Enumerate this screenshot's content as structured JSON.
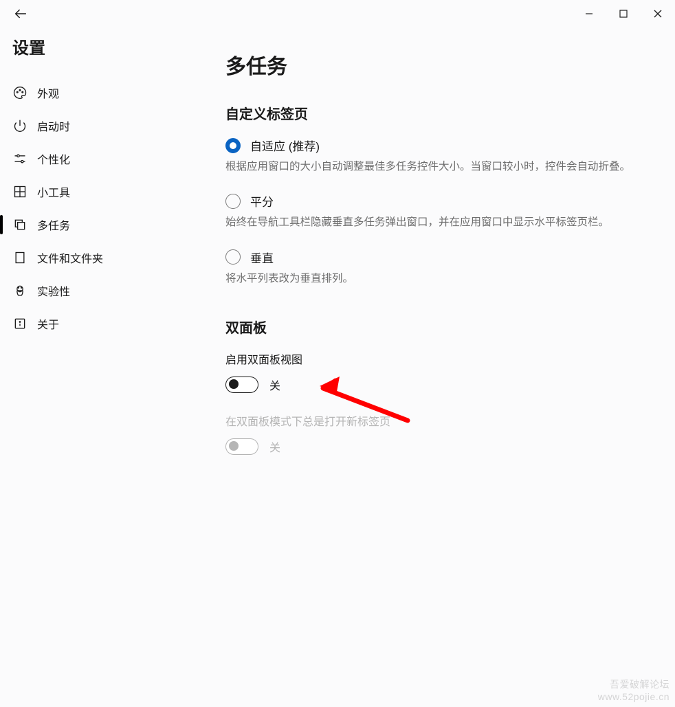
{
  "window_controls": {
    "minimize": "minimize",
    "maximize": "maximize",
    "close": "close"
  },
  "sidebar": {
    "title": "设置",
    "items": [
      {
        "label": "外观",
        "icon": "palette"
      },
      {
        "label": "启动时",
        "icon": "power"
      },
      {
        "label": "个性化",
        "icon": "sliders"
      },
      {
        "label": "小工具",
        "icon": "grid"
      },
      {
        "label": "多任务",
        "icon": "copy",
        "active": true
      },
      {
        "label": "文件和文件夹",
        "icon": "folder"
      },
      {
        "label": "实验性",
        "icon": "flask"
      },
      {
        "label": "关于",
        "icon": "info"
      }
    ]
  },
  "main": {
    "title": "多任务",
    "section_tabs_title": "自定义标签页",
    "radios": [
      {
        "label": "自适应 (推荐)",
        "selected": true,
        "desc": "根据应用窗口的大小自动调整最佳多任务控件大小。当窗口较小时，控件会自动折叠。"
      },
      {
        "label": "平分",
        "selected": false,
        "desc": "始终在导航工具栏隐藏垂直多任务弹出窗口，并在应用窗口中显示水平标签页栏。"
      },
      {
        "label": "垂直",
        "selected": false,
        "desc": "将水平列表改为垂直排列。"
      }
    ],
    "section_dual_title": "双面板",
    "toggles": [
      {
        "label": "启用双面板视图",
        "state": "关",
        "disabled": false
      },
      {
        "label": "在双面板模式下总是打开新标签页",
        "state": "关",
        "disabled": true
      }
    ]
  },
  "watermark": {
    "line1": "吾爱破解论坛",
    "line2": "www.52pojie.cn"
  }
}
